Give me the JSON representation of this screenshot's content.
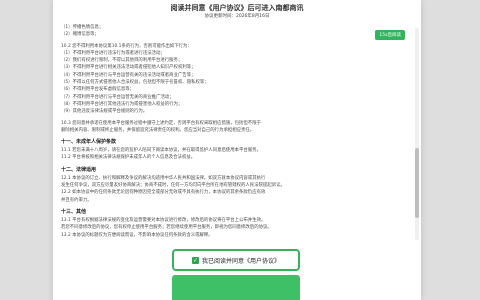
{
  "dialog": {
    "title": "阅读并同意《用户协议》后可进入南都商讯",
    "subtitle": "协议更新时间：2026年8月16日",
    "read_badge": "15s后阅读",
    "agree_label": "我已阅读并同意《用户协议》"
  },
  "content": {
    "block_a": [
      "（1）传播色情信息；",
      "（2）赌博信息等；"
    ],
    "block_b": [
      "10.2 您不得利用本协议第10.1条的行为，否则可能作出如下行为：",
      "（1）不得利用平台进行违法行为或者进行违法活动；",
      "（2）我们有权进行限制，不得以其他目的利用平台进行服务；",
      "（3）不得利用平台进行相关违法活动或者侵犯他人知识产权权利等；",
      "（4）不得利用平台进行与平台运营有关的违法活动或者商业广告等；",
      "（5）不得以任何方式侵害他人合法权益，包括但不限于名誉权、隐私权等；",
      "（6）不得利用平台发布虚假信息等；",
      "（7）不得利用平台进行与平台运营无关的商业推广活动；",
      "（8）不得利用平台进行其他违法行为或侵害他人权益的行为；",
      "（9）其他违反法律法规或平台规则的行为。"
    ],
    "block_c": [
      "10.3 您同意并承诺在使用本平台服务过程中遵守上述约定，否则平台有权采取相应措施，包括但不限于",
      "删除相关内容、限制或终止服务，并保留追究法律责任的权利。您应当对自己的行为承担相应责任。"
    ],
    "section_11_title": "十一、未成年人保护条款",
    "block_d": [
      "11.1 若您未满十八周岁，请在您的监护人陪同下阅读本协议，并在取得监护人同意后使用本平台服务。",
      "11.2 平台将按照相关法律法规保护未成年人的个人信息及合法权益。"
    ],
    "section_12_title": "十二、法律适用",
    "block_e": [
      "12.1 本协议的订立、执行和解释及争议的解决均适用中华人民共和国法律。如双方就本协议内容或其执行",
      "发生任何争议，双方应尽量友好协商解决；协商不成时，任何一方均可向平台所在地有管辖权的人民法院提起诉讼。",
      "12.2 如本协议中的任何条款无论因何种原因完全或部分无效或不具有执行力，本协议的其余条款仍应有效",
      "并且有约束力。"
    ],
    "section_13_title": "十三、其他",
    "block_f": [
      "13.1 平台有权根据法律法规的变化及运营需要对本协议进行修改，修改后的协议将在平台上公布并生效。",
      "若您不同意修改后的协议，您有权停止使用平台服务；若您继续使用平台服务，即视为您同意修改后的协议。",
      "13.2 本协议的标题仅为方便阅读而设，不影响本协议任何条款的含义或解释。"
    ]
  }
}
